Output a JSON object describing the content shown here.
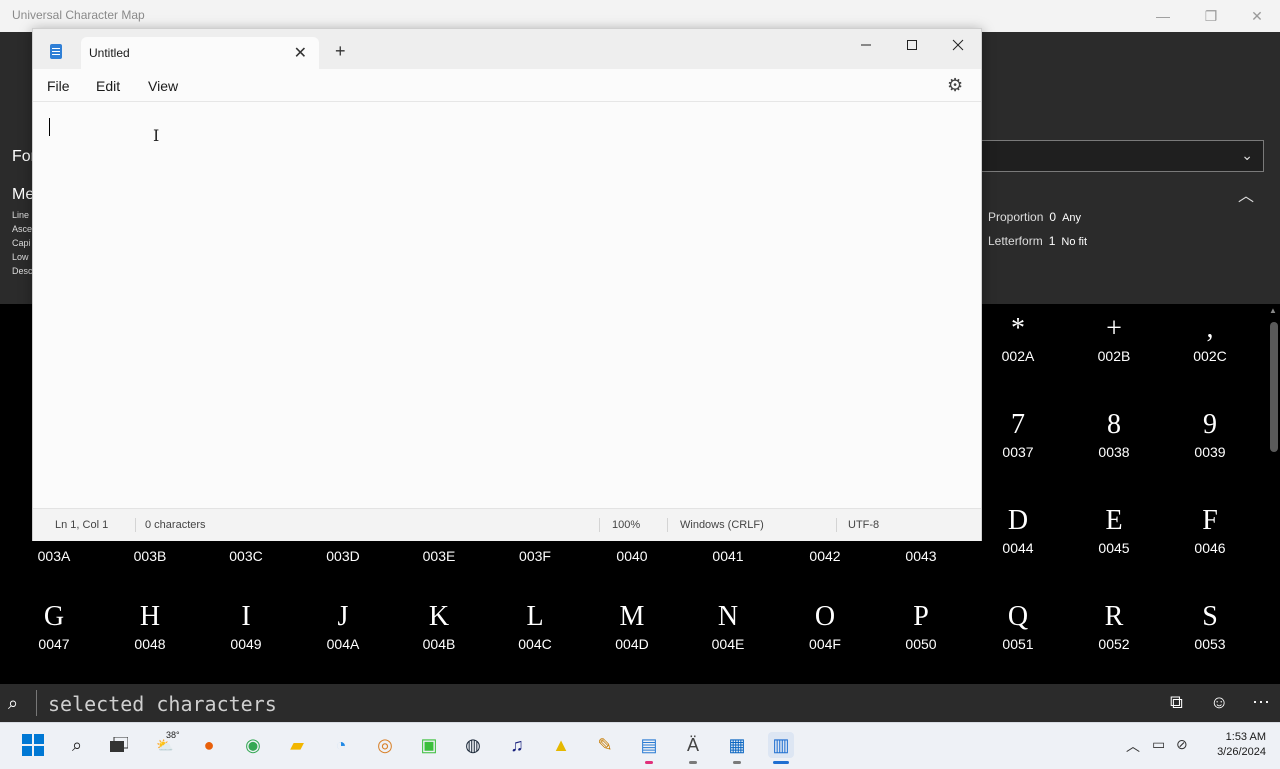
{
  "ucm": {
    "title": "Universal Character Map",
    "winbtns": {
      "minimize": "—",
      "restore": "❐",
      "close": "✕"
    },
    "left_labels": {
      "font": "For",
      "metrics": "Me",
      "tiny": [
        "Line",
        "Asce",
        "Capi",
        "Low",
        "Desc"
      ]
    },
    "properties": [
      {
        "label": "Proportion",
        "num": "0",
        "value": "Any"
      },
      {
        "label": "Letterform",
        "num": "1",
        "value": "No fit"
      }
    ],
    "grid_rows": [
      [
        {
          "glyph": "*",
          "code": "002A"
        },
        {
          "glyph": "+",
          "code": "002B"
        },
        {
          "glyph": ",",
          "code": "002C"
        }
      ],
      [
        {
          "glyph": "7",
          "code": "0037"
        },
        {
          "glyph": "8",
          "code": "0038"
        },
        {
          "glyph": "9",
          "code": "0039"
        }
      ],
      [
        {
          "glyph": "D",
          "code": "0044"
        },
        {
          "glyph": "E",
          "code": "0045"
        },
        {
          "glyph": "F",
          "code": "0046"
        }
      ],
      [
        {
          "glyph": "G",
          "code": "0047"
        },
        {
          "glyph": "H",
          "code": "0048"
        },
        {
          "glyph": "I",
          "code": "0049"
        },
        {
          "glyph": "J",
          "code": "004A"
        },
        {
          "glyph": "K",
          "code": "004B"
        },
        {
          "glyph": "L",
          "code": "004C"
        },
        {
          "glyph": "M",
          "code": "004D"
        },
        {
          "glyph": "N",
          "code": "004E"
        },
        {
          "glyph": "O",
          "code": "004F"
        },
        {
          "glyph": "P",
          "code": "0050"
        },
        {
          "glyph": "Q",
          "code": "0051"
        },
        {
          "glyph": "R",
          "code": "0052"
        },
        {
          "glyph": "S",
          "code": "0053"
        }
      ]
    ],
    "codes_row": [
      "003A",
      "003B",
      "003C",
      "003D",
      "003E",
      "003F",
      "0040",
      "0041",
      "0042",
      "0043"
    ],
    "search": {
      "placeholder": "selected characters"
    }
  },
  "notepad": {
    "tab_title": "Untitled",
    "tab_close": "✕",
    "new_tab": "+",
    "menu": [
      "File",
      "Edit",
      "View"
    ],
    "status": {
      "position": "Ln 1, Col 1",
      "characters": "0 characters",
      "zoom": "100%",
      "line_ending": "Windows (CRLF)",
      "encoding": "UTF-8"
    }
  },
  "taskbar": {
    "weather_temp": "38°",
    "time": "1:53 AM",
    "date": "3/26/2024"
  }
}
